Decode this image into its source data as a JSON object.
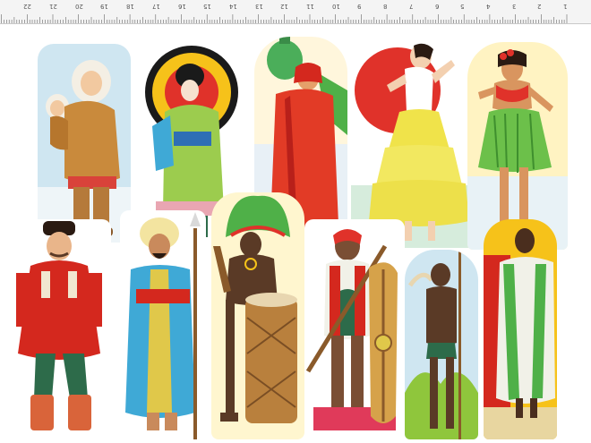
{
  "ruler": {
    "labels": [
      "1",
      "2",
      "3",
      "4",
      "5",
      "6",
      "7",
      "8",
      "9",
      "10",
      "11",
      "12",
      "13",
      "14",
      "15",
      "16",
      "17",
      "18",
      "19",
      "20",
      "21",
      "22",
      "23"
    ]
  },
  "figures": [
    {
      "name": "arctic-mother-with-child",
      "colors": {
        "coat": "#c98a3c",
        "bg": "#cfe6f1"
      }
    },
    {
      "name": "japanese-woman-kimono",
      "colors": {
        "kimono": "#9ccc4e",
        "sun": "#f6c21a"
      }
    },
    {
      "name": "woman-with-water-jar",
      "colors": {
        "robe": "#e23b26",
        "jar": "#4bae5a"
      }
    },
    {
      "name": "flamenco-dancer",
      "colors": {
        "skirt": "#f0e34a",
        "sun": "#e0322a"
      }
    },
    {
      "name": "hula-dancer",
      "colors": {
        "skirt": "#6cc04a",
        "lei": "#e0322a"
      }
    },
    {
      "name": "cossack-man",
      "colors": {
        "coat": "#d4281e",
        "pants": "#2d6b4a"
      }
    },
    {
      "name": "turbaned-man-with-spear",
      "colors": {
        "robe": "#3fa9d6",
        "turban": "#f3e4a0"
      }
    },
    {
      "name": "drummer-with-feather-headdress",
      "colors": {
        "drum": "#b9803d",
        "feathers": "#4fb048"
      }
    },
    {
      "name": "man-with-shield-and-spear",
      "colors": {
        "shield": "#d6a24a",
        "vest": "#d4281e"
      }
    },
    {
      "name": "warrior-with-horn",
      "colors": {
        "skin": "#5a3a26",
        "bg": "#cfe6f1"
      }
    },
    {
      "name": "man-in-white-toga",
      "colors": {
        "toga": "#f1f1e8",
        "stripe": "#4fb048"
      }
    }
  ]
}
